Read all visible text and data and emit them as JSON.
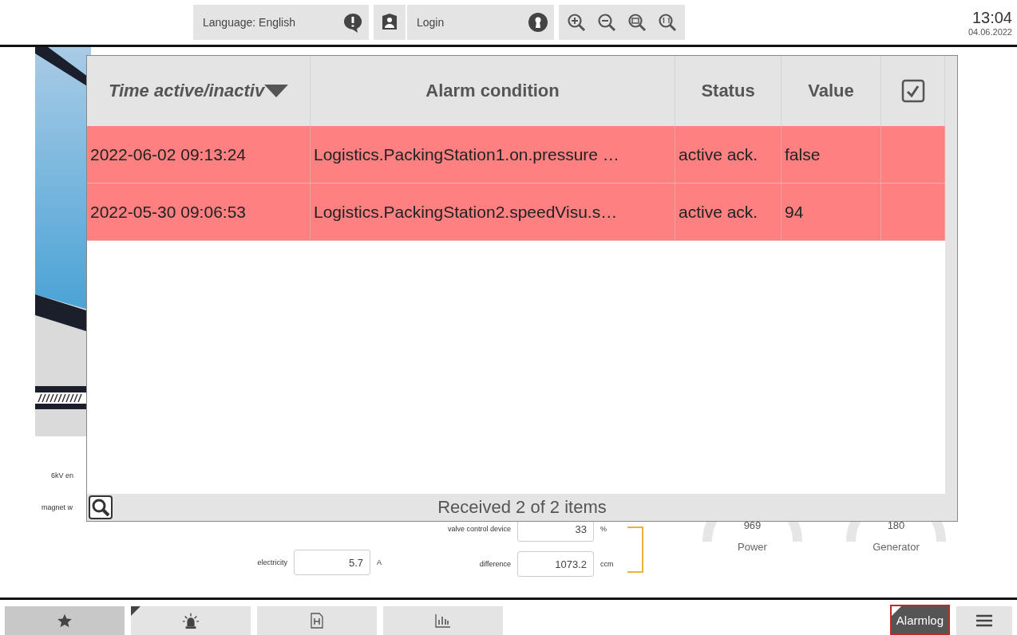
{
  "topbar": {
    "language": "Language: English",
    "login": "Login",
    "time": "13:04",
    "date": "04.06.2022"
  },
  "process": {
    "labels": [
      {
        "text": "6kV en"
      },
      {
        "text": "magnet w"
      }
    ],
    "fields": [
      {
        "label": "electricity",
        "value": "5.7",
        "unit": "A"
      },
      {
        "label": "valve control device",
        "value": "33",
        "unit": "%"
      },
      {
        "label": "difference",
        "value": "1073.2",
        "unit": "ccm"
      }
    ],
    "gauges": [
      {
        "value": "969",
        "label": "Power"
      },
      {
        "value": "180",
        "label": "Generator"
      }
    ]
  },
  "alarm_dialog": {
    "columns": [
      {
        "label": "Time active/inactiv",
        "sorted": true
      },
      {
        "label": "Alarm condition",
        "sorted": false
      },
      {
        "label": "Status",
        "sorted": false
      },
      {
        "label": "Value",
        "sorted": false
      }
    ],
    "rows": [
      {
        "time": "2022-06-02 09:13:24",
        "condition": "Logistics.PackingStation1.on.pressure …",
        "status": "active ack.",
        "value": "false",
        "active": true
      },
      {
        "time": "2022-05-30 09:06:53",
        "condition": "Logistics.PackingStation2.speedVisu.s…",
        "status": "active ack.",
        "value": "94",
        "active": true
      }
    ],
    "footer": "Received 2 of 2 items"
  },
  "bottom_nav": {
    "items": [
      {
        "kind": "favorites",
        "selected": true
      },
      {
        "kind": "alarms",
        "selected": false
      },
      {
        "kind": "document",
        "selected": false
      },
      {
        "kind": "chart",
        "selected": false
      }
    ],
    "alarmlog": {
      "label": "Alarmlog",
      "selected": true
    }
  }
}
